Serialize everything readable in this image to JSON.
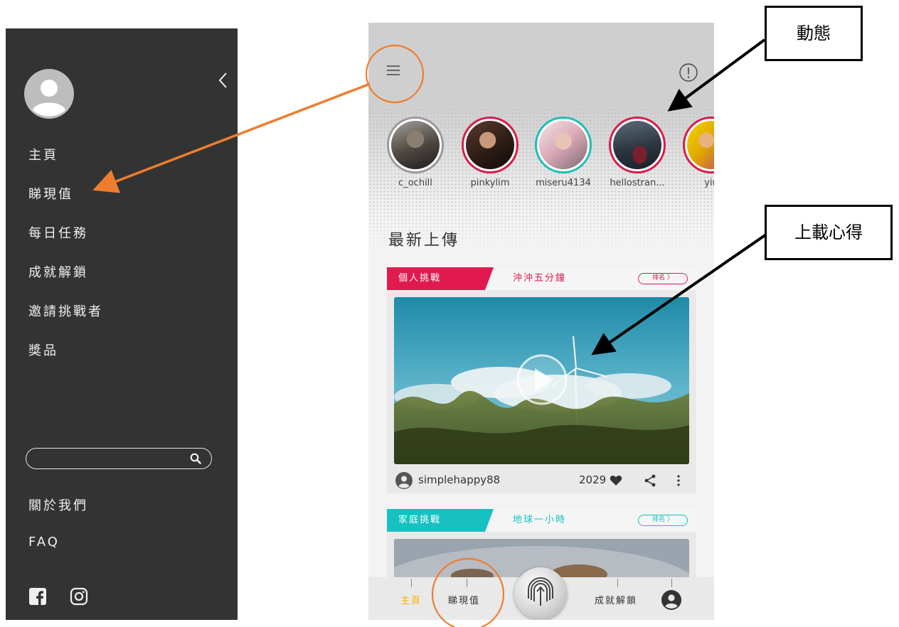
{
  "drawer": {
    "menu": [
      "主頁",
      "睇現值",
      "每日任務",
      "成就解鎖",
      "邀請挑戰者",
      "獎品"
    ],
    "search": {
      "placeholder": ""
    },
    "about_label": "關於我們",
    "faq_label": "FAQ",
    "colors": {
      "background": "#333333",
      "text": "#f0f0f0"
    },
    "icons": [
      "avatar-icon",
      "chevron-left-icon",
      "search-icon",
      "facebook-icon",
      "instagram-icon"
    ]
  },
  "phone": {
    "stories": [
      {
        "name": "c_ochill",
        "ring_color": "#9a9a9a"
      },
      {
        "name": "pinkylim",
        "ring_color": "#d81b4a"
      },
      {
        "name": "miseru4134",
        "ring_color": "#1bbfb5"
      },
      {
        "name": "hellostran...",
        "ring_color": "#d81b4a"
      },
      {
        "name": "yiu",
        "ring_color": "#d81b4a"
      }
    ],
    "section_title": "最新上傳",
    "cards": [
      {
        "category": "個人挑戰",
        "challenge": "沖沖五分鐘",
        "rank_label": "排名 〉",
        "accent": "#e01a4f",
        "user": "simplehappy88",
        "likes": "2029"
      },
      {
        "category": "家庭挑戰",
        "challenge": "地球一小時",
        "rank_label": "排名 〉",
        "accent": "#17c1c1"
      }
    ],
    "tabbar": {
      "home": "主頁",
      "value": "睇現值",
      "achievements": "成就解鎖",
      "home_color": "#f5b400"
    }
  },
  "annotations": {
    "moments_label": "動態",
    "upload_label": "上載心得",
    "arrow_colors": {
      "orange": "#ee7d2f",
      "black": "#000000"
    }
  }
}
